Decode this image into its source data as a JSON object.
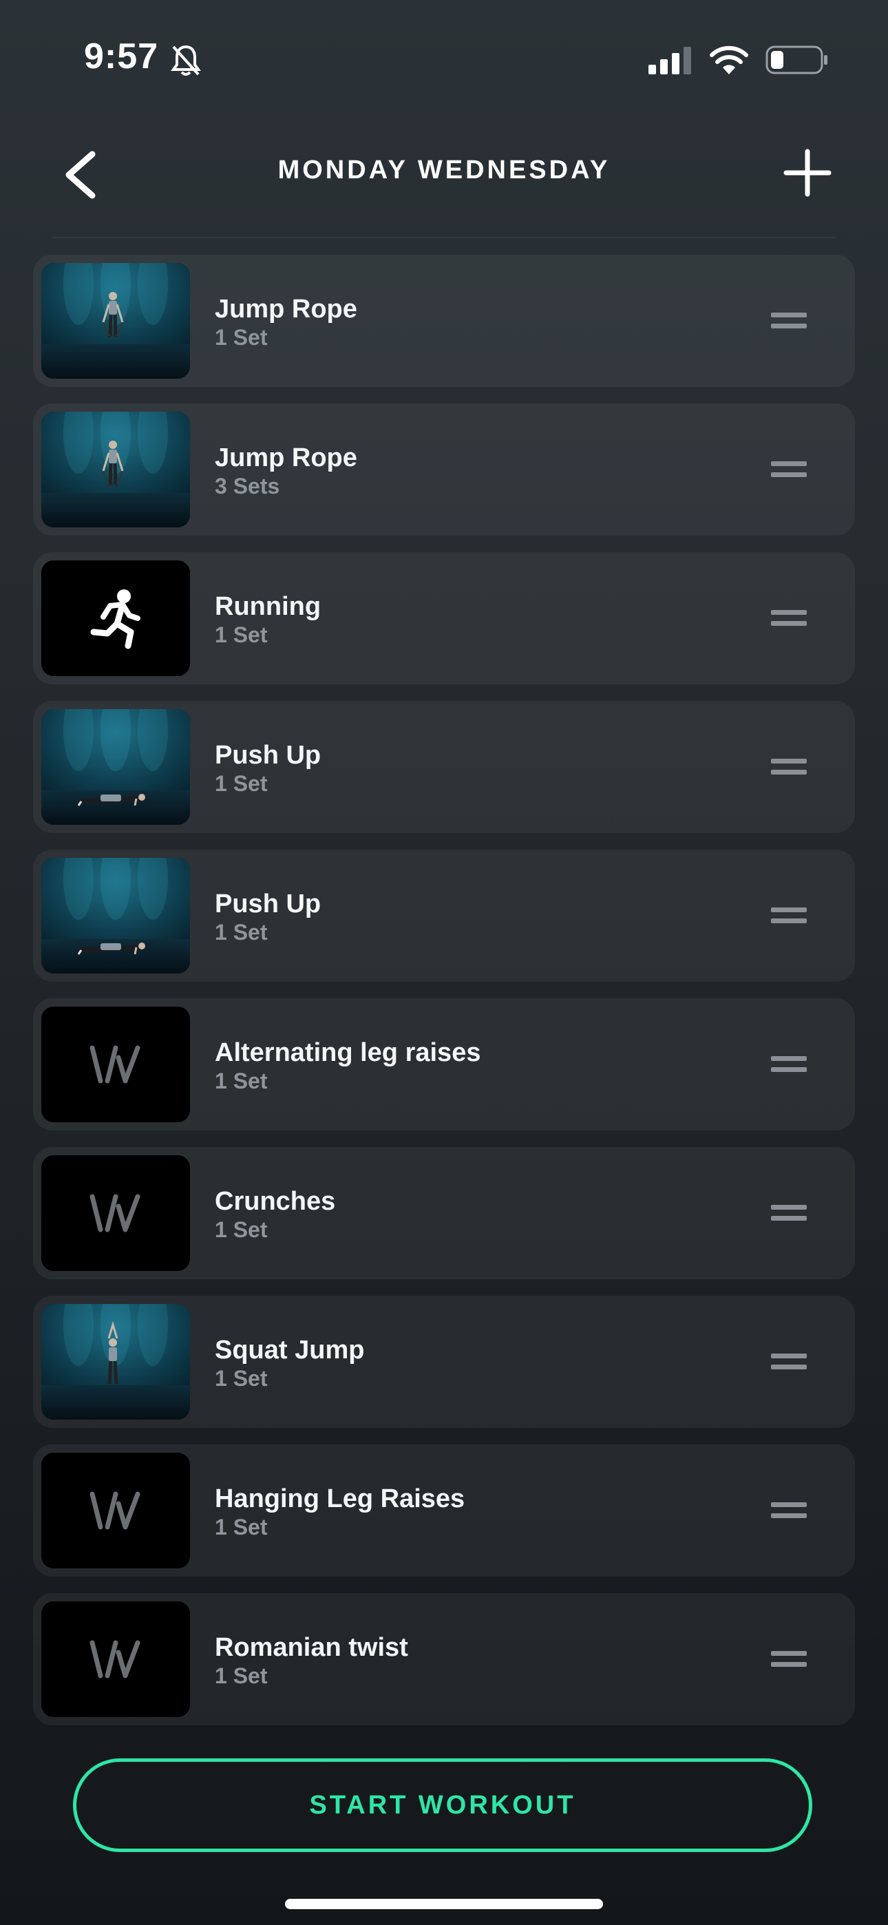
{
  "status": {
    "time": "9:57",
    "icons": [
      "bell-slash-icon",
      "cellular-signal-icon",
      "wifi-icon",
      "battery-icon"
    ],
    "battery_level_percent": 25
  },
  "header": {
    "title": "MONDAY WEDNESDAY",
    "back_icon": "chevron-left-icon",
    "add_icon": "plus-icon"
  },
  "exercises": [
    {
      "name": "Jump Rope",
      "sets": "1 Set",
      "thumb": "video-jump-rope"
    },
    {
      "name": "Jump Rope",
      "sets": "3 Sets",
      "thumb": "video-jump-rope"
    },
    {
      "name": "Running",
      "sets": "1 Set",
      "thumb": "running-icon"
    },
    {
      "name": "Push Up",
      "sets": "1 Set",
      "thumb": "video-push-up"
    },
    {
      "name": "Push Up",
      "sets": "1 Set",
      "thumb": "video-push-up"
    },
    {
      "name": "Alternating leg raises",
      "sets": "1 Set",
      "thumb": "logo-placeholder"
    },
    {
      "name": "Crunches",
      "sets": "1 Set",
      "thumb": "logo-placeholder"
    },
    {
      "name": "Squat Jump",
      "sets": "1 Set",
      "thumb": "video-squat-jump"
    },
    {
      "name": "Hanging Leg Raises",
      "sets": "1 Set",
      "thumb": "logo-placeholder"
    },
    {
      "name": "Romanian twist",
      "sets": "1 Set",
      "thumb": "logo-placeholder"
    }
  ],
  "start_button": {
    "label": "START WORKOUT"
  },
  "colors": {
    "accent": "#2ee6a6",
    "background_top": "#2b3237",
    "background_bottom": "#14171a",
    "secondary_text": "#8e969b"
  }
}
